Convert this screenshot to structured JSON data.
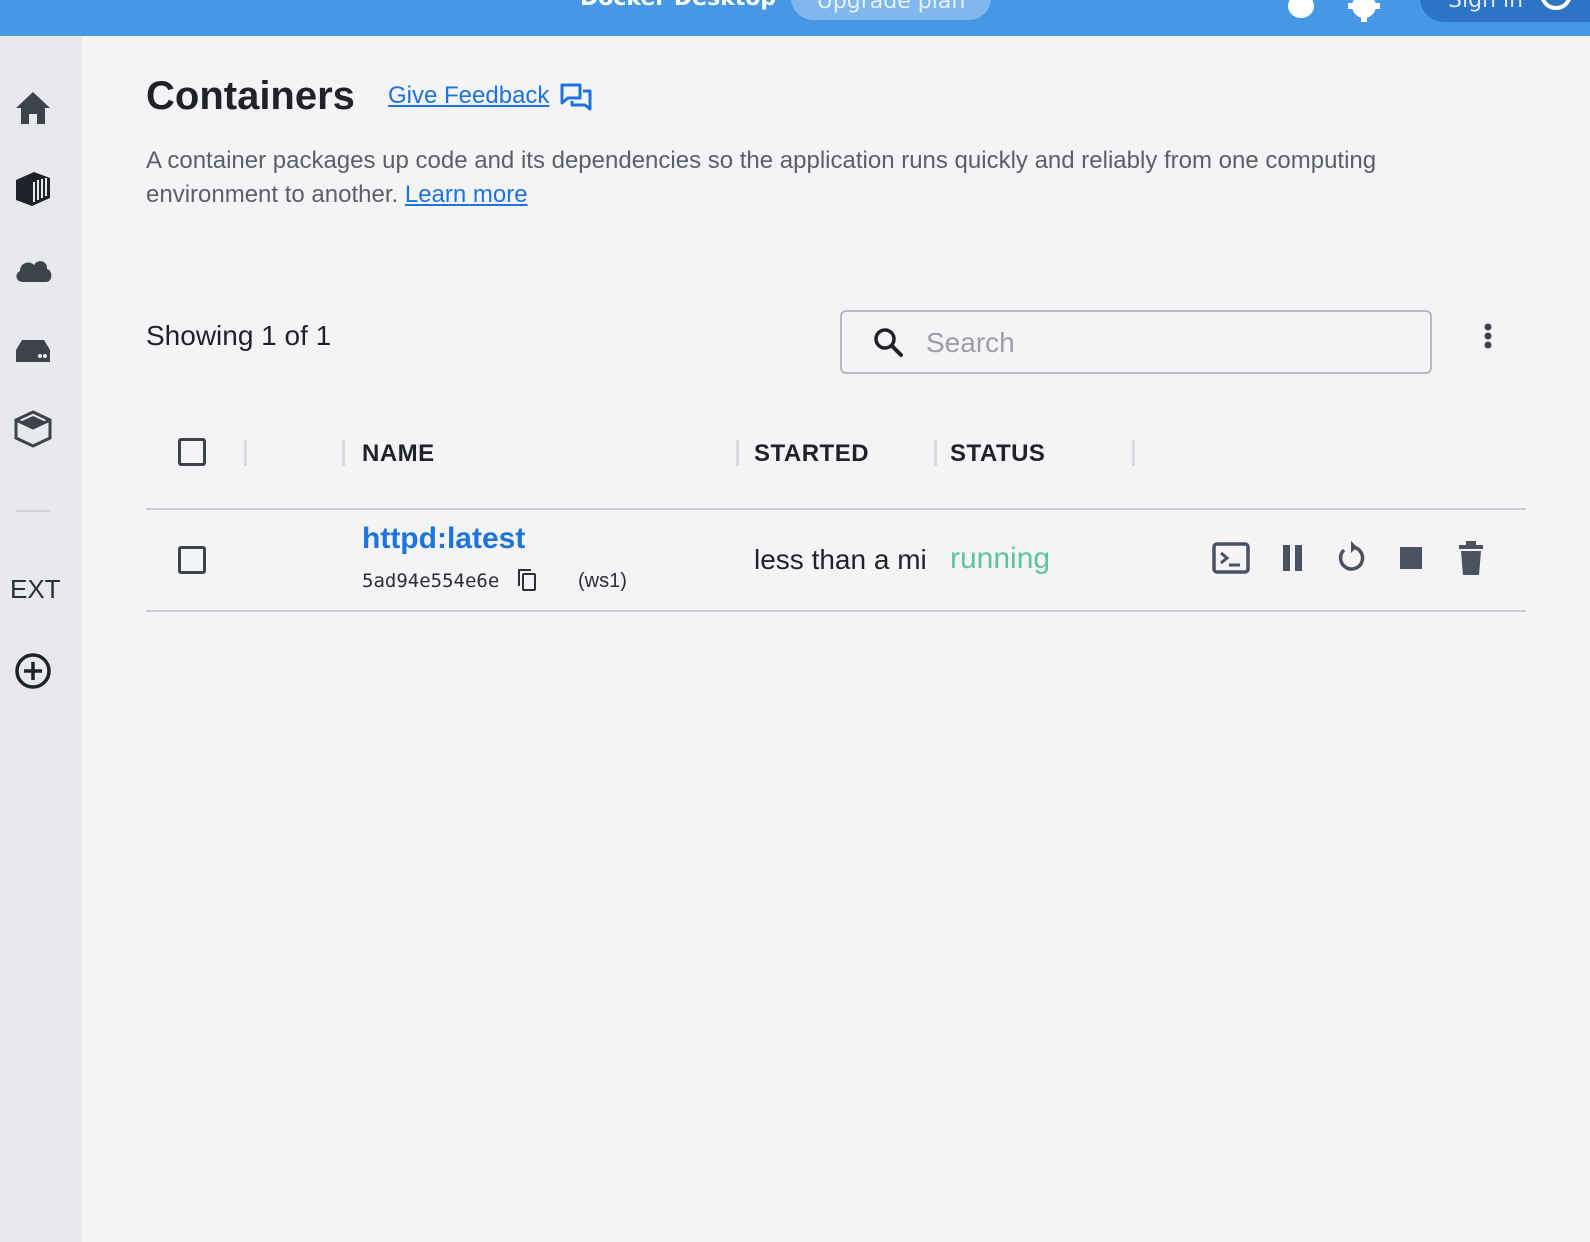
{
  "topbar": {
    "app_title": "Docker Desktop",
    "upgrade_label": "Upgrade plan",
    "signin_label": "Sign in"
  },
  "sidebar": {
    "items": [
      {
        "name": "home",
        "icon": "home-icon"
      },
      {
        "name": "containers",
        "icon": "container-icon"
      },
      {
        "name": "cloud",
        "icon": "cloud-icon"
      },
      {
        "name": "volumes",
        "icon": "volume-icon"
      },
      {
        "name": "dev-environments",
        "icon": "box-icon"
      }
    ],
    "ext_label": "EXT",
    "add_icon": "add-extension-icon"
  },
  "header": {
    "title": "Containers",
    "feedback_label": "Give Feedback",
    "description": "A container packages up code and its dependencies so the application runs quickly and reliably from one computing environment to another.",
    "learn_more_label": "Learn more"
  },
  "toolbar": {
    "showing_text": "Showing 1 of 1",
    "search_placeholder": "Search"
  },
  "table": {
    "columns": [
      "NAME",
      "STARTED",
      "STATUS"
    ],
    "rows": [
      {
        "name": "httpd:latest",
        "id": "5ad94e554e6e",
        "host": "(ws1)",
        "started": "less than a mi",
        "status": "running"
      }
    ]
  },
  "colors": {
    "topbar": "#4698e6",
    "link": "#1d74e0",
    "running": "#5fc59b",
    "icon": "#4a5160"
  }
}
